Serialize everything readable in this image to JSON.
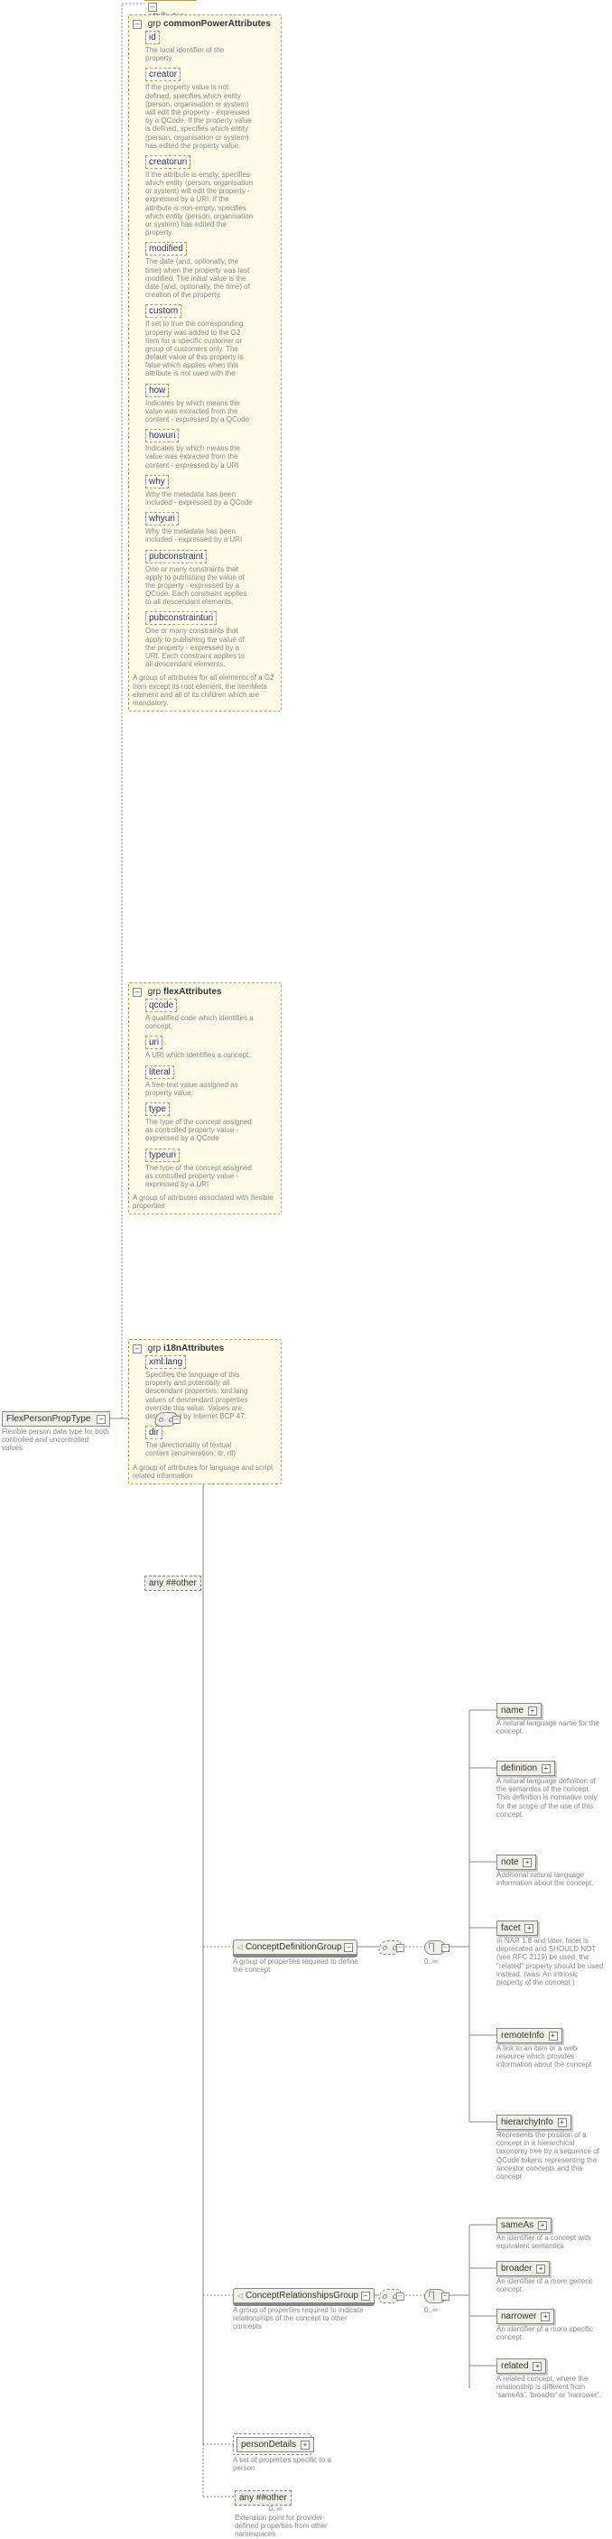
{
  "root": {
    "name": "FlexPersonPropType",
    "desc": "Flexible person data type for both controlled and uncontrolled values"
  },
  "attributes_label": "attributes",
  "grp_label": "grp",
  "commonPower": {
    "title": "commonPowerAttributes",
    "attrs": [
      {
        "name": "id",
        "desc": "The local identifier of the property."
      },
      {
        "name": "creator",
        "desc": "If the property value is not defined, specifies which entity (person, organisation or system) will edit the property - expressed by a QCode. If the property value is defined, specifies which entity (person, organisation or system) has edited the property value."
      },
      {
        "name": "creatoruri",
        "desc": "If the attribute is empty, specifies which entity (person, organisation or system) will edit the property - expressed by a URI. If the attribute is non-empty, specifies which entity (person, organisation or system) has edited the property."
      },
      {
        "name": "modified",
        "desc": "The date (and, optionally, the time) when the property was last modified. The initial value is the date (and, optionally, the time) of creation of the property."
      },
      {
        "name": "custom",
        "desc": "If set to true the corresponding property was added to the G2 Item for a specific customer or group of customers only. The default value of this property is false which applies when this attribute is not used with the"
      },
      {
        "name": "how",
        "desc": "Indicates by which means the value was extracted from the content - expressed by a QCode"
      },
      {
        "name": "howuri",
        "desc": "Indicates by which means the value was extracted from the content - expressed by a URI"
      },
      {
        "name": "why",
        "desc": "Why the metadata has been included - expressed by a QCode"
      },
      {
        "name": "whyuri",
        "desc": "Why the metadata has been included - expressed by a URI"
      },
      {
        "name": "pubconstraint",
        "desc": "One or many constraints that apply to publishing the value of the property - expressed by a QCode. Each constraint applies to all descendant elements."
      },
      {
        "name": "pubconstrainturi",
        "desc": "One or many constraints that apply to publishing the value of the property - expressed by a URI. Each constraint applies to all descendant elements."
      }
    ],
    "group_desc": "A group of attributes for all elements of a G2 Item except its root element, the itemMeta element and all of its children which are mandatory."
  },
  "flex": {
    "title": "flexAttributes",
    "attrs": [
      {
        "name": "qcode",
        "desc": "A qualified code which identifies a concept."
      },
      {
        "name": "uri",
        "desc": "A URI which identifies a concept."
      },
      {
        "name": "literal",
        "desc": "A free-text value assigned as property value."
      },
      {
        "name": "type",
        "desc": "The type of the concept assigned as controlled property value - expressed by a QCode"
      },
      {
        "name": "typeuri",
        "desc": "The type of the concept assigned as controlled property value - expressed by a URI"
      }
    ],
    "group_desc": "A group of attributes associated with flexible properties"
  },
  "i18n": {
    "title": "i18nAttributes",
    "attrs": [
      {
        "name": "xml:lang",
        "desc": "Specifies the language of this property and potentially all descendant properties. xml:lang values of descendant properties override this value. Values are determined by Internet BCP 47."
      },
      {
        "name": "dir",
        "desc": "The directionality of textual content (enumeration: ltr, rtl)"
      }
    ],
    "group_desc": "A group of attributes for language and script related information"
  },
  "any_attr": "any ##other",
  "cdg": {
    "title": "ConceptDefinitionGroup",
    "desc": "A group of properties required to define the concept"
  },
  "crg": {
    "title": "ConceptRelationshipsGroup",
    "desc": "A group of properties required to indicate relationships of the concept to other concepts"
  },
  "cdg_elements": [
    {
      "name": "name",
      "desc": "A natural language name for the concept."
    },
    {
      "name": "definition",
      "desc": "A natural language definition of the semantics of the concept. This definition is normative only for the scope of the use of this concept."
    },
    {
      "name": "note",
      "desc": "Additional natural language information about the concept."
    },
    {
      "name": "facet",
      "desc": "In NAR 1.8 and later, facet is deprecated and SHOULD NOT (see RFC 2119) be used, the \"related\" property should be used instead. (was: An intrinsic property of the concept.)"
    },
    {
      "name": "remoteInfo",
      "desc": "A link to an item or a web resource which provides information about the concept"
    },
    {
      "name": "hierarchyInfo",
      "desc": "Represents the position of a concept in a hierarchical taxonomy tree by a sequence of QCode tokens representing the ancestor concepts and this concept"
    }
  ],
  "crg_elements": [
    {
      "name": "sameAs",
      "desc": "An identifier of a concept with equivalent semantics"
    },
    {
      "name": "broader",
      "desc": "An identifier of a more generic concept."
    },
    {
      "name": "narrower",
      "desc": "An identifier of a more specific concept."
    },
    {
      "name": "related",
      "desc": "A related concept, where the relationship is different from 'sameAs', 'broader' or 'narrower'."
    }
  ],
  "personDetails": {
    "name": "personDetails",
    "desc": "A set of properties specific to a person"
  },
  "any_el": {
    "label": "any ##other",
    "desc": "Extension point for provider-defined properties from other namespaces"
  },
  "occurs": {
    "zero_inf": "0..∞"
  },
  "symbols": {
    "plus": "+",
    "minus": "–"
  }
}
